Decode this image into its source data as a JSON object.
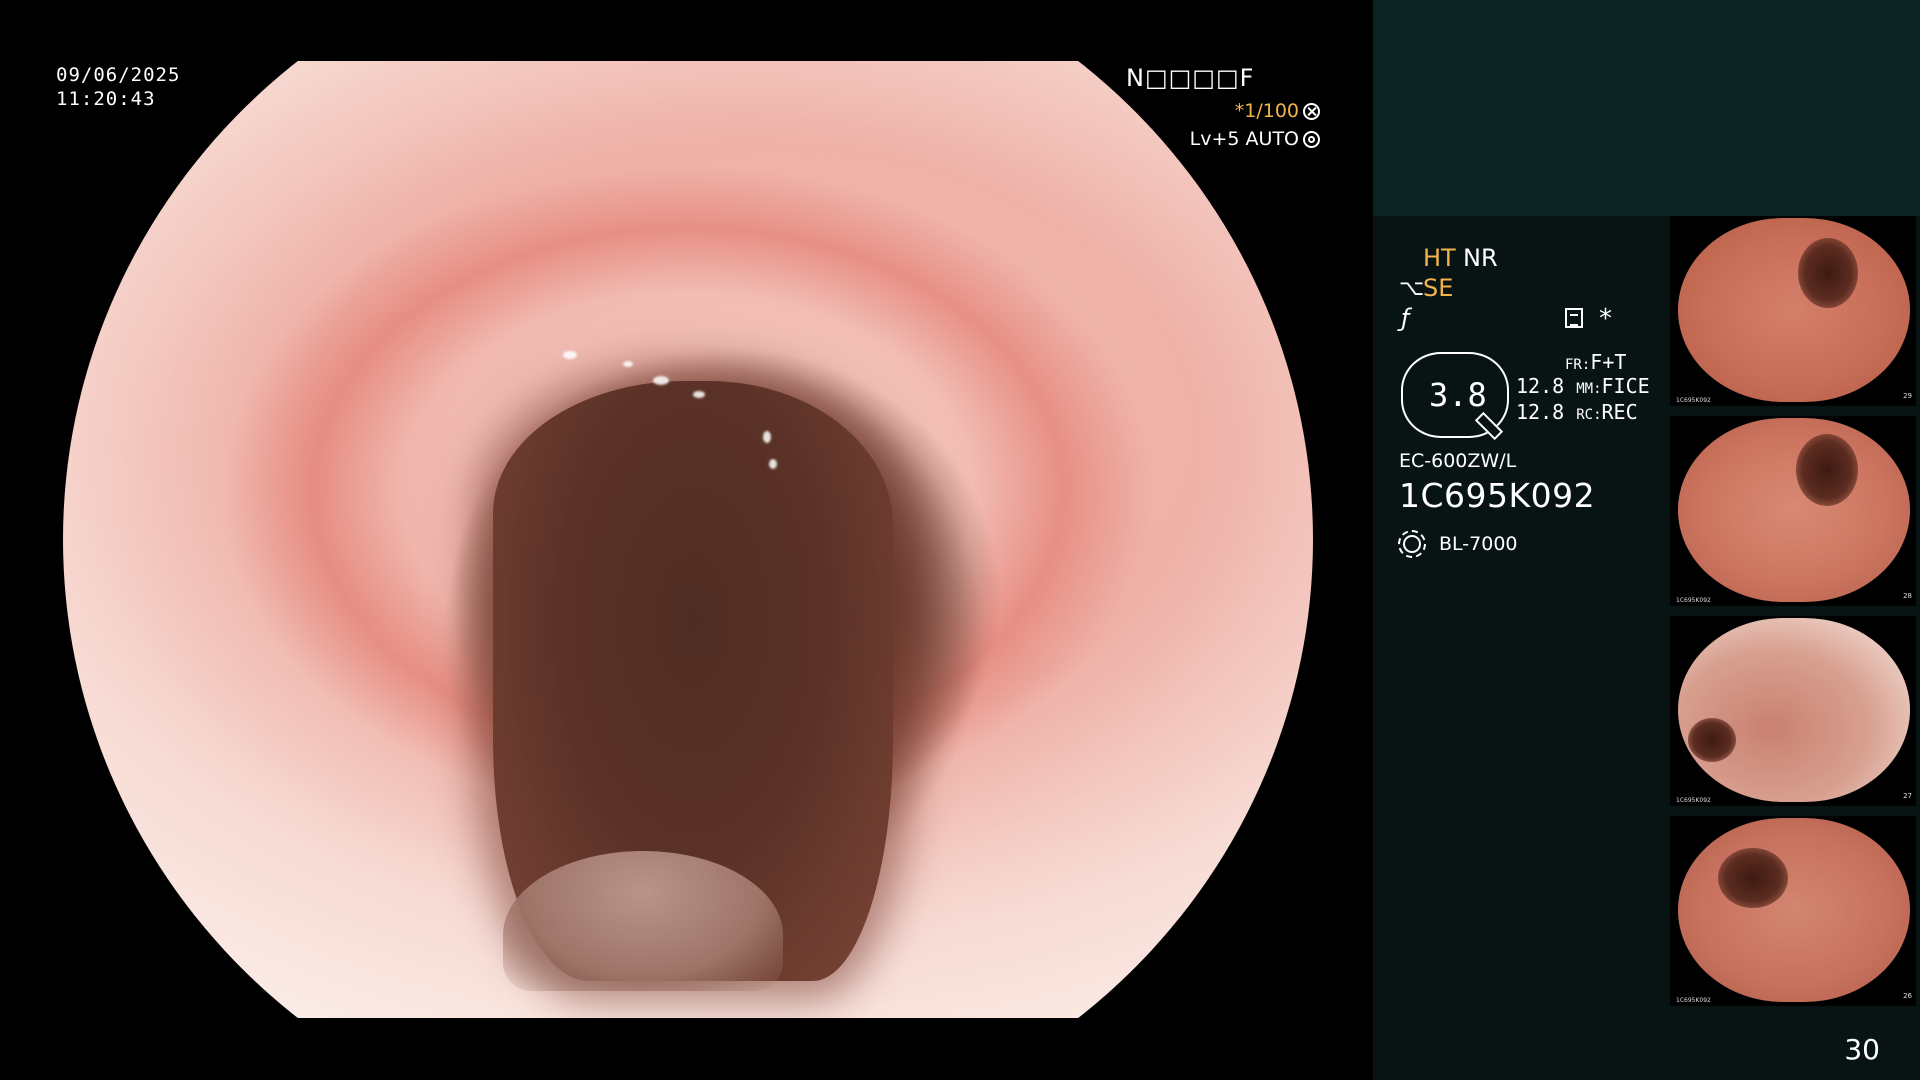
{
  "overlay": {
    "date": "09/06/2025",
    "time": "11:20:43",
    "patient_id": "N□□□□F",
    "shutter": "*1/100",
    "level": "Lv+5 AUTO"
  },
  "panel": {
    "ht": "HT",
    "nr": "NR",
    "se": "SE",
    "asterisk": "*",
    "zoom_value": "3.8",
    "settings": {
      "fr_label": "FR:",
      "fr_value": "F+T",
      "mm_num": "12.8",
      "mm_label": "MM:",
      "mm_value": "FICE",
      "rc_num": "12.8",
      "rc_label": "RC:",
      "rc_value": "REC"
    },
    "scope_model": "EC-600ZW/L",
    "scope_serial": "1C695K092",
    "light_source": "BL-7000"
  },
  "thumbnails": [
    {
      "num": "29",
      "foot": "1C695K092"
    },
    {
      "num": "28",
      "foot": "1C695K092"
    },
    {
      "num": "27",
      "foot": "1C695K092"
    },
    {
      "num": "26",
      "foot": "1C695K092"
    }
  ],
  "page_number": "30",
  "colors": {
    "accent": "#f3b54a",
    "panel_bg": "#081414",
    "panel_top_bg": "#0b2323"
  }
}
